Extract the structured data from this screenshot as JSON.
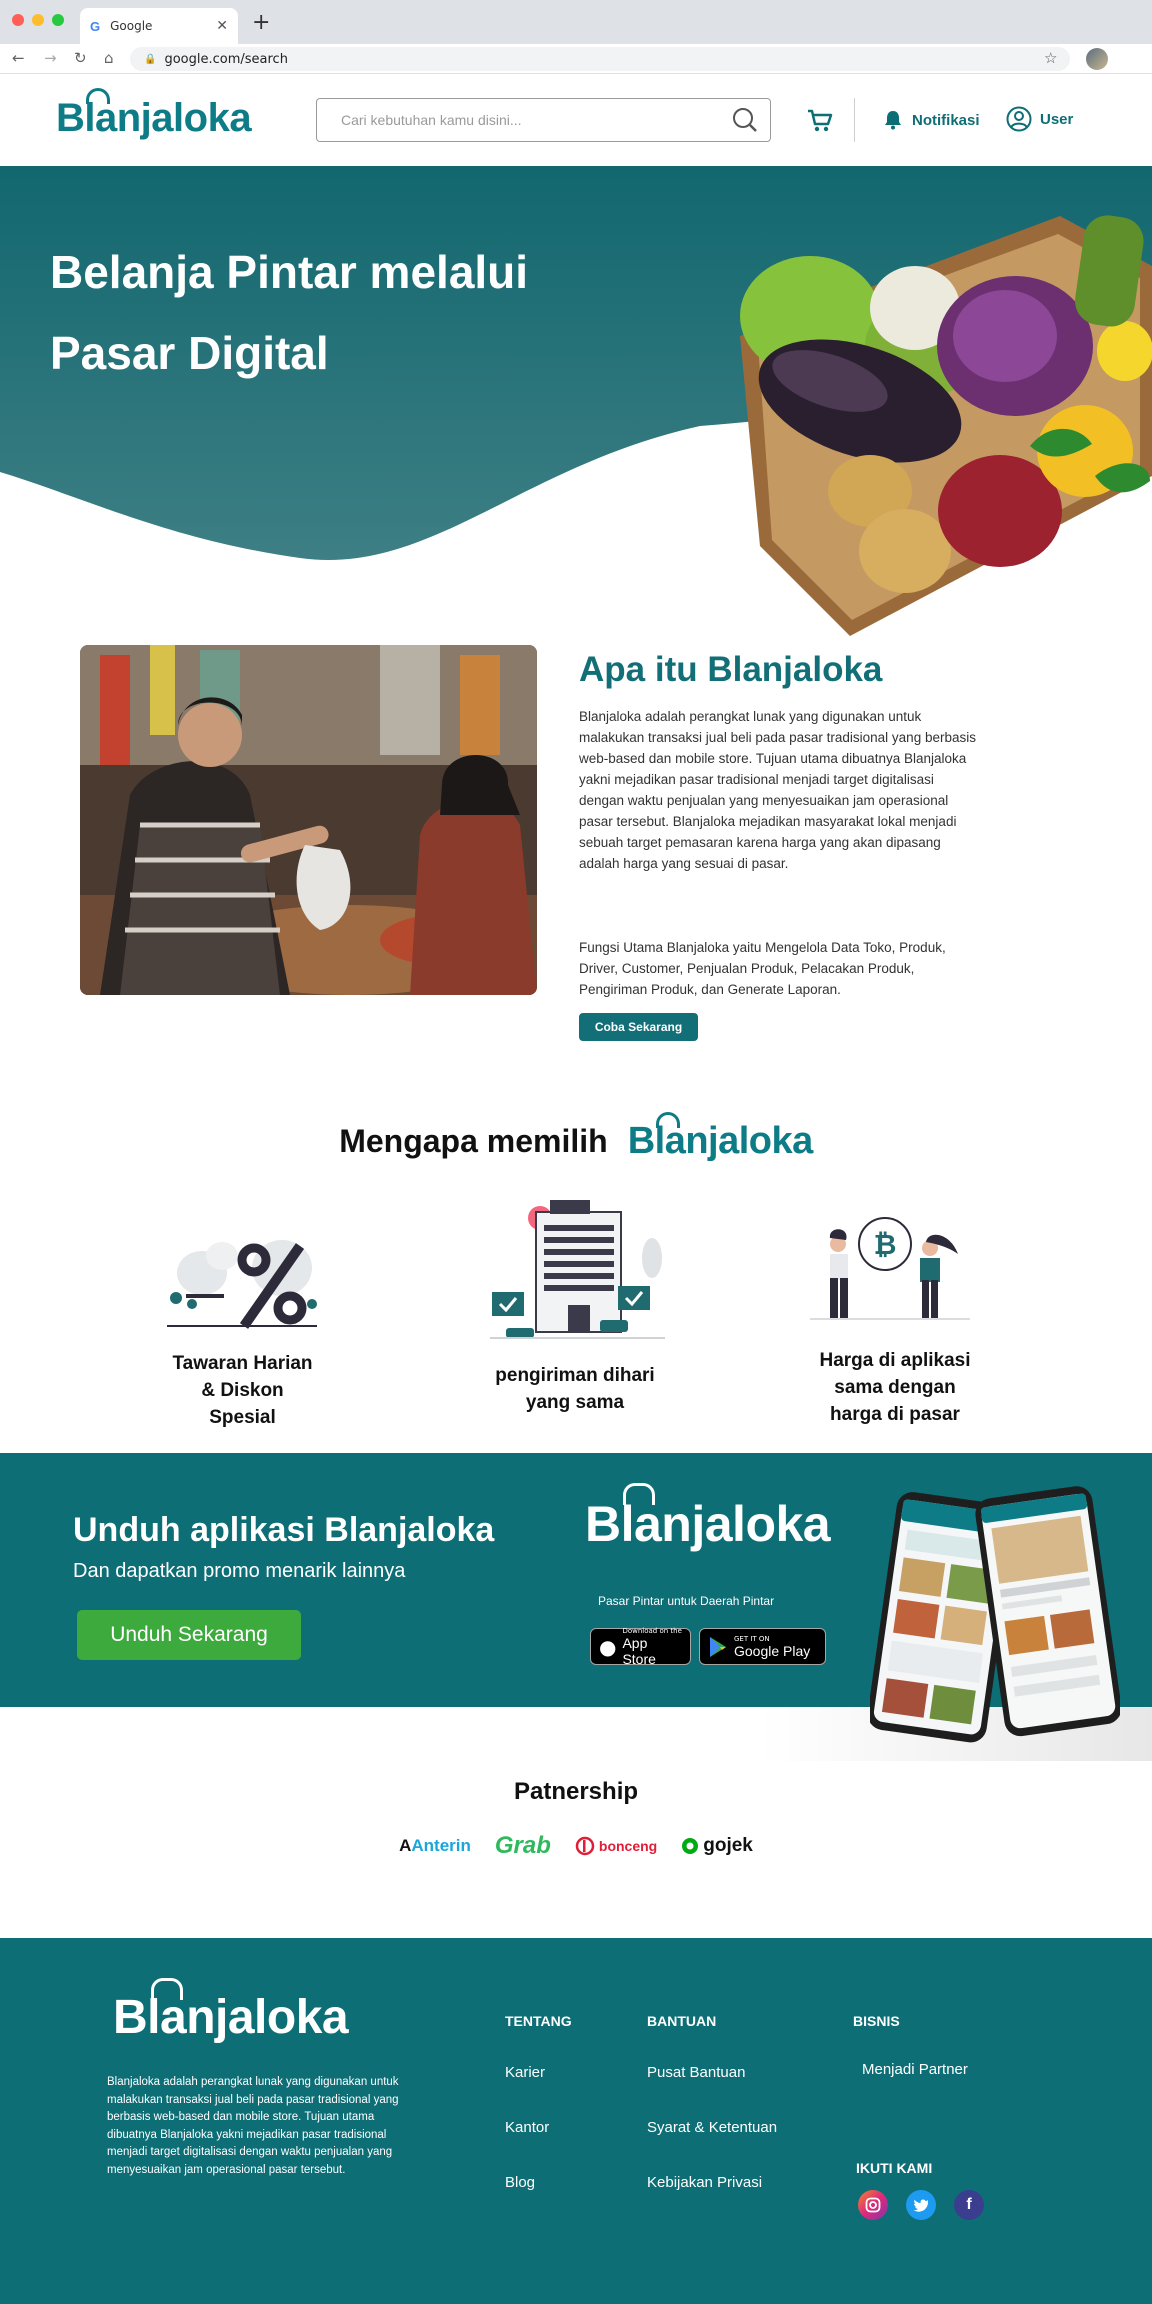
{
  "browser": {
    "tab_title": "Google",
    "url": "google.com/search"
  },
  "header": {
    "logo_text": "Blanjaloka",
    "search_placeholder": "Cari kebutuhan kamu disini...",
    "notif_label": "Notifikasi",
    "user_label": "User"
  },
  "hero": {
    "title_line1": "Belanja Pintar melalui",
    "title_line2": "Pasar Digital"
  },
  "about": {
    "title": "Apa itu Blanjaloka",
    "paragraph1": "Blanjaloka adalah perangkat lunak yang digunakan untuk malakukan transaksi jual beli pada pasar tradisional yang berbasis web-based dan mobile store. Tujuan utama dibuatnya Blanjaloka yakni mejadikan pasar tradisional menjadi target digitalisasi dengan waktu penjualan yang menyesuaikan jam operasional pasar tersebut. Blanjaloka mejadikan masyarakat lokal menjadi sebuah target pemasaran karena harga yang akan dipasang adalah harga yang sesuai di pasar.",
    "paragraph2": "Fungsi Utama Blanjaloka yaitu Mengelola Data Toko, Produk, Driver, Customer, Penjualan Produk, Pelacakan Produk, Pengiriman Produk, dan Generate Laporan.",
    "button": "Coba Sekarang"
  },
  "why": {
    "title": "Mengapa memilih",
    "logo_text": "Blanjaloka",
    "features": [
      {
        "line1": "Tawaran Harian",
        "line2": "& Diskon",
        "line3": "Spesial",
        "icon": "discount-percent-icon"
      },
      {
        "line1": "pengiriman dihari",
        "line2": "yang sama",
        "icon": "delivery-building-icon"
      },
      {
        "line1": "Harga di aplikasi",
        "line2": "sama dengan",
        "line3": "harga di pasar",
        "icon": "price-exchange-icon"
      }
    ]
  },
  "download": {
    "title": "Unduh aplikasi Blanjaloka",
    "subtitle": "Dan dapatkan  promo menarik lainnya",
    "button": "Unduh Sekarang",
    "logo_text": "Blanjaloka",
    "tagline": "Pasar Pintar untuk Daerah Pintar",
    "appstore_small": "Download on the",
    "appstore_big": "App Store",
    "gplay_small": "GET IT ON",
    "gplay_big": "Google Play"
  },
  "partnership": {
    "title": "Patnership",
    "partners": [
      {
        "name": "Anterin",
        "prefix": "A"
      },
      {
        "name": "Grab"
      },
      {
        "name": "bonceng"
      },
      {
        "name": "gojek"
      }
    ]
  },
  "footer": {
    "logo_text": "Blanjaloka",
    "description": "Blanjaloka adalah perangkat lunak yang digunakan untuk malakukan transaksi jual beli pada pasar tradisional yang berbasis web-based dan mobile store. Tujuan utama dibuatnya Blanjaloka yakni mejadikan pasar tradisional menjadi target digitalisasi dengan waktu penjualan yang menyesuaikan jam operasional pasar tersebut.",
    "tentang": {
      "title": "TENTANG",
      "links": [
        "Karier",
        "Kantor",
        "Blog"
      ]
    },
    "bantuan": {
      "title": "BANTUAN",
      "links": [
        "Pusat Bantuan",
        "Syarat & Ketentuan",
        "Kebijakan Privasi"
      ]
    },
    "bisnis": {
      "title": "BISNIS",
      "links": [
        "Menjadi Partner"
      ]
    },
    "follow_title": "IKUTI KAMI",
    "social": [
      "instagram-icon",
      "twitter-icon",
      "facebook-icon"
    ]
  },
  "colors": {
    "brand_teal": "#0e7c86",
    "band_teal": "#0d6e76",
    "button_green": "#3daa3d"
  }
}
